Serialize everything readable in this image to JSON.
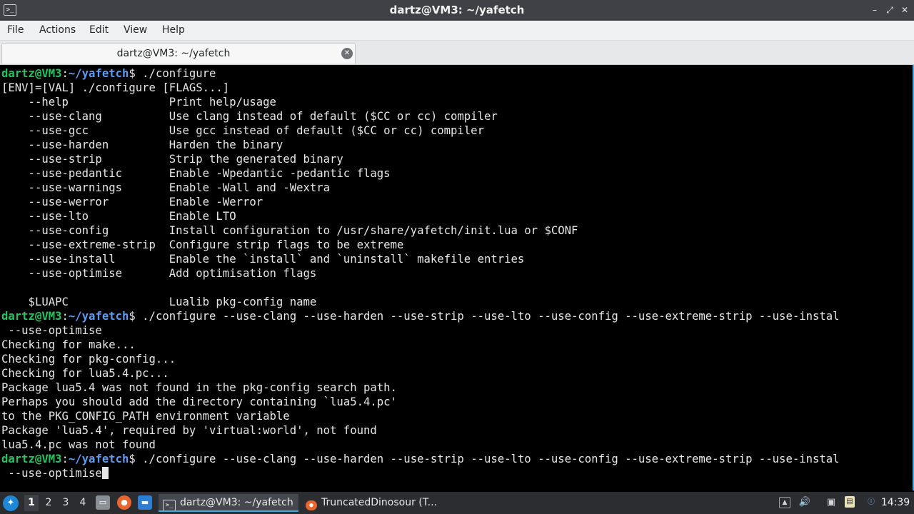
{
  "window": {
    "title": "dartz@VM3: ~/yafetch",
    "buttons": {
      "minimize": "–",
      "restore": "⤢",
      "close": "✕"
    }
  },
  "menu": {
    "items": [
      "File",
      "Actions",
      "Edit",
      "View",
      "Help"
    ]
  },
  "tab": {
    "label": "dartz@VM3: ~/yafetch",
    "close_icon": "✕"
  },
  "terminal": {
    "prompt_user": "dartz@VM3",
    "prompt_path": "~/yafetch",
    "prompt_symbol": "$",
    "commands": [
      " ./configure",
      " ./configure --use-clang --use-harden --use-strip --use-lto --use-config --use-extreme-strip --use-instal",
      " ./configure --use-clang --use-harden --use-strip --use-lto --use-config --use-extreme-strip --use-instal"
    ],
    "help_usage": "[ENV]=[VAL] ./configure [FLAGS...]",
    "help_rows": [
      "    --help               Print help/usage",
      "    --use-clang          Use clang instead of default ($CC or cc) compiler",
      "    --use-gcc            Use gcc instead of default ($CC or cc) compiler",
      "    --use-harden         Harden the binary",
      "    --use-strip          Strip the generated binary",
      "    --use-pedantic       Enable -Wpedantic -pedantic flags",
      "    --use-warnings       Enable -Wall and -Wextra",
      "    --use-werror         Enable -Werror",
      "    --use-lto            Enable LTO",
      "    --use-config         Install configuration to /usr/share/yafetch/init.lua or $CONF",
      "    --use-extreme-strip  Configure strip flags to be extreme",
      "    --use-install        Enable the `install` and `uninstall` makefile entries",
      "    --use-optimise       Add optimisation flags",
      "",
      "    $LUAPC               Lualib pkg-config name"
    ],
    "wrap_line": " --use-optimise",
    "output_lines": [
      "Checking for make...",
      "Checking for pkg-config...",
      "Checking for lua5.4.pc...",
      "Package lua5.4 was not found in the pkg-config search path.",
      "Perhaps you should add the directory containing `lua5.4.pc'",
      "to the PKG_CONFIG_PATH environment variable",
      "Package 'lua5.4', required by 'virtual:world', not found",
      "lua5.4.pc was not found"
    ]
  },
  "taskbar": {
    "workspaces": [
      "1",
      "2",
      "3",
      "4"
    ],
    "active_workspace": "1",
    "quick_launch_icons": [
      "file-manager-icon",
      "firefox-icon",
      "show-desktop-icon"
    ],
    "tasks": [
      {
        "label": "dartz@VM3: ~/yafetch",
        "icon": "terminal-icon",
        "active": true
      },
      {
        "label": "TruncatedDinosour (T...",
        "icon": "firefox-icon",
        "active": false
      }
    ],
    "tray_icons": [
      "tray-up-icon",
      "volume-icon",
      "network-icon",
      "clipboard-icon",
      "update-notifier-icon"
    ],
    "clock": "14:39"
  },
  "colors": {
    "prompt_user": "#22c55e",
    "prompt_path": "#5b9cf2",
    "accent": "#3daee9"
  }
}
